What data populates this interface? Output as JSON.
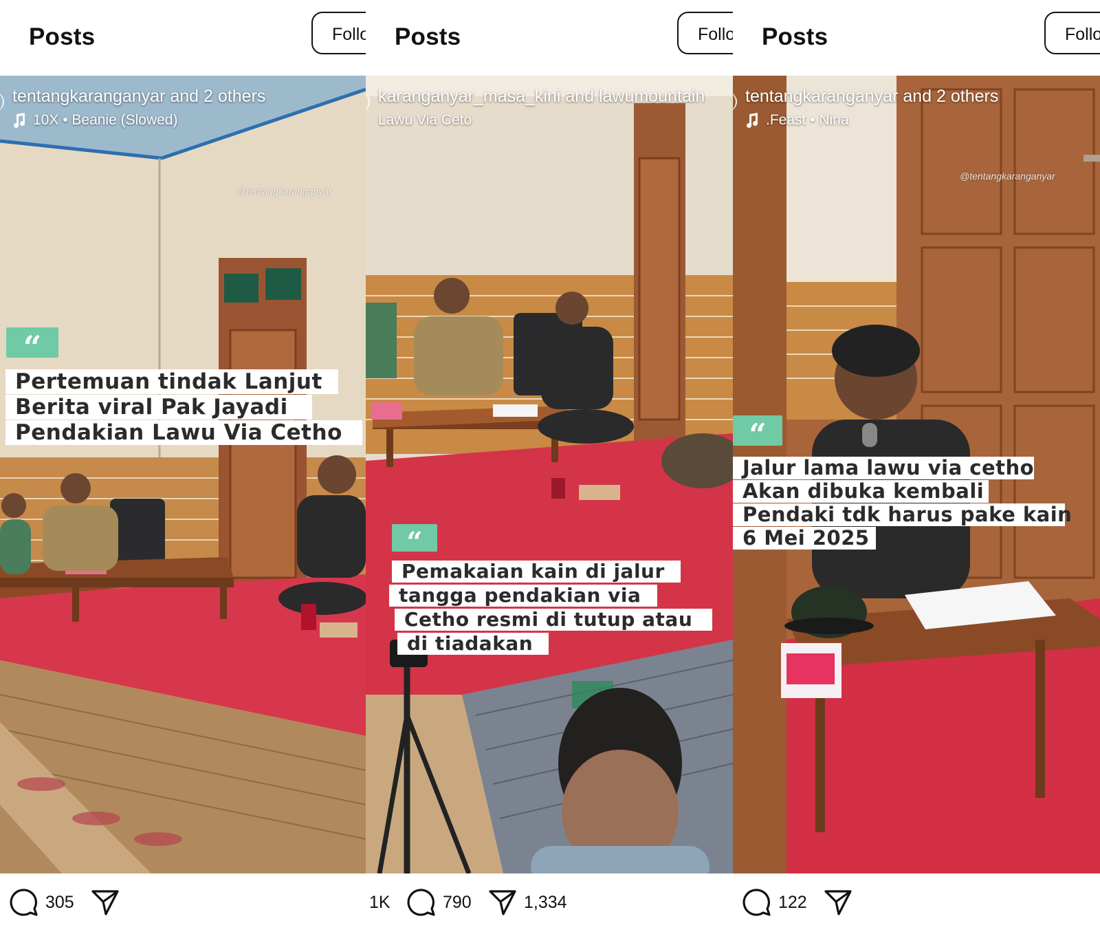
{
  "panels": [
    {
      "header": {
        "title": "Posts",
        "follow_label": "Follo"
      },
      "author": {
        "user": "tentangkaranganyar",
        "rest": " and 2 others"
      },
      "audio": {
        "text": "10X • Beanie (Slowed)",
        "icon": "music-note-icon"
      },
      "watermark": "@tentangkaranganyar",
      "caption_lines": [
        "Pertemuan tindak Lanjut",
        "Berita viral Pak Jayadi",
        "Pendakian Lawu Via Cetho"
      ],
      "stats": {
        "likes": "",
        "comments": "305",
        "shares": ""
      }
    },
    {
      "header": {
        "title": "Posts",
        "follow_label": "Follo"
      },
      "author": {
        "user": "karanganyar_masa_kini",
        "rest": " and lawumountain"
      },
      "audio": {
        "text": "Lawu Via Ceto",
        "icon": ""
      },
      "watermark": "",
      "caption_lines": [
        "Pemakaian kain di jalur",
        "tangga pendakian via",
        "Cetho resmi di tutup atau",
        " di tiadakan"
      ],
      "stats": {
        "likes": "1K",
        "comments": "790",
        "shares": "1,334"
      }
    },
    {
      "header": {
        "title": "Posts",
        "follow_label": "Follo"
      },
      "author": {
        "user": "tentangkaranganyar",
        "rest": " and 2 others"
      },
      "audio": {
        "text": ".Feast • Nina",
        "icon": "music-note-icon"
      },
      "watermark": "@tentangkaranganyar",
      "caption_lines": [
        "Jalur lama lawu via cetho",
        "Akan dibuka kembali",
        "Pendaki tdk harus pake kain",
        "6 Mei 2025"
      ],
      "stats": {
        "likes": "",
        "comments": "122",
        "shares": ""
      }
    }
  ],
  "colors": {
    "quote_badge": "#6fcaa5",
    "carpet_red": "#d8334a",
    "wall_cream": "#e9dcc8",
    "brick_orange": "#c98a45",
    "wood_brown": "#8a4a26"
  },
  "icons": [
    "comment-icon",
    "send-icon",
    "music-note-icon",
    "quote-icon"
  ]
}
